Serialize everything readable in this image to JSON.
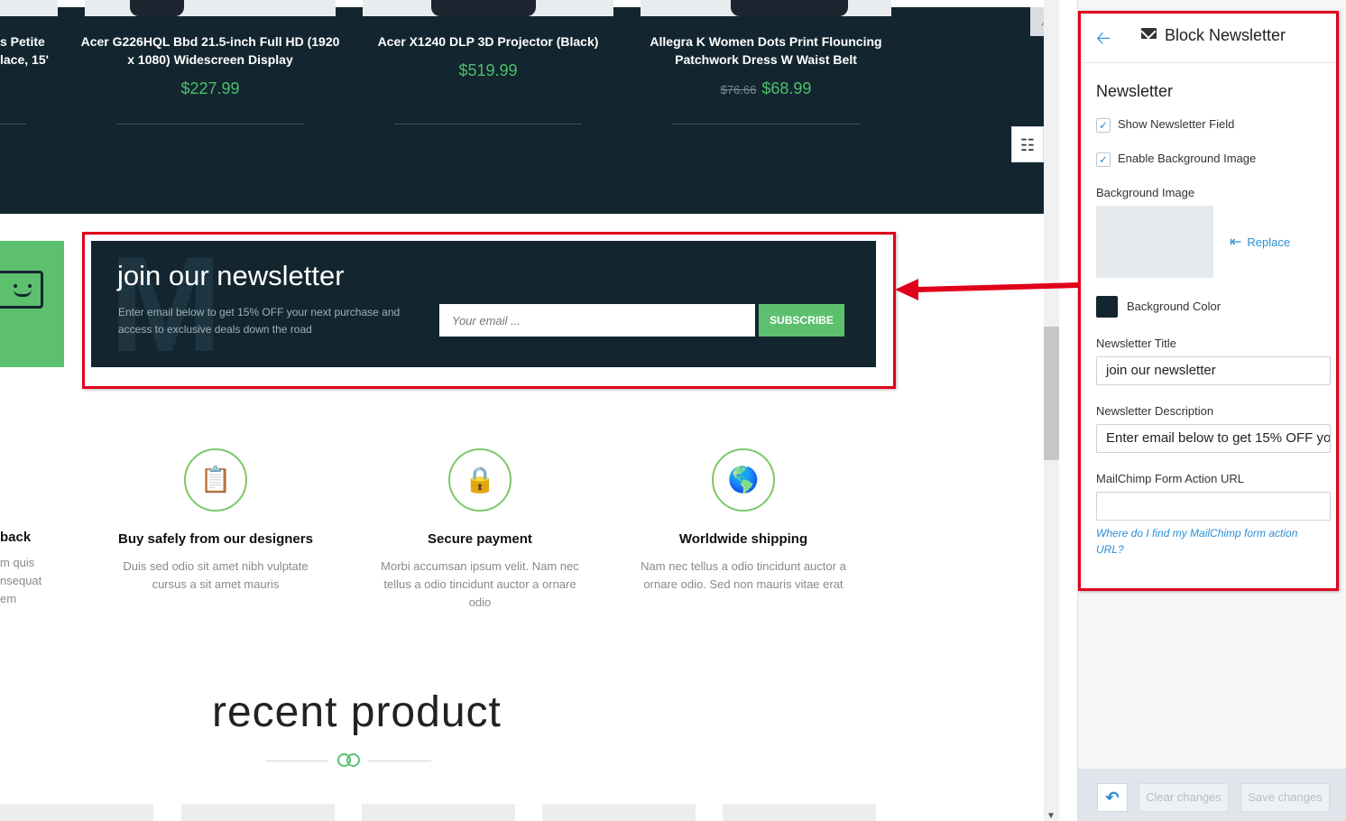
{
  "products": [
    {
      "name": "Acer G226HQL Bbd 21.5-inch Full HD (1920 x 1080) Widescreen Display",
      "price": "$227.99",
      "old_price": ""
    },
    {
      "name": "Acer X1240 DLP 3D Projector (Black)",
      "price": "$519.99",
      "old_price": ""
    },
    {
      "name": "Allegra K Women Dots Print Flouncing Patchwork Dress W Waist Belt",
      "price": "$68.99",
      "old_price": "$76.66"
    }
  ],
  "partial_product_name": "s Petite\nlace, 15'",
  "newsletter": {
    "title": "join our newsletter",
    "description": "Enter email below to get 15% OFF your next purchase and access to exclusive deals down the road",
    "placeholder": "Your email ...",
    "button": "SUBSCRIBE"
  },
  "features": [
    {
      "title": "Buy safely from our designers",
      "desc": "Duis sed odio sit amet nibh vulptate cursus a sit amet mauris",
      "icon": "clipboard-check-icon"
    },
    {
      "title": "Secure payment",
      "desc": "Morbi accumsan ipsum velit. Nam nec tellus a odio tincidunt auctor a ornare odio",
      "icon": "lock-icon"
    },
    {
      "title": "Worldwide shipping",
      "desc": "Nam nec tellus a odio tincidunt auctor a ornare odio. Sed non mauris vitae erat",
      "icon": "globe-icon"
    }
  ],
  "partial_feature": {
    "title": "back",
    "desc": "m quis\nnsequat\nem"
  },
  "recent_title": "recent product",
  "panel": {
    "title": "Block Newsletter",
    "section": "Newsletter",
    "show_field_label": "Show Newsletter Field",
    "show_field_checked": true,
    "enable_bg_label": "Enable Background Image",
    "enable_bg_checked": true,
    "bg_image_label": "Background Image",
    "replace_label": "Replace",
    "bg_color_label": "Background Color",
    "bg_color": "#13262f",
    "title_label": "Newsletter Title",
    "title_value": "join our newsletter",
    "desc_label": "Newsletter Description",
    "desc_value": "Enter email below to get 15% OFF yo",
    "mailchimp_label": "MailChimp Form Action URL",
    "mailchimp_value": "",
    "help_link": "Where do I find my MailChimp form action URL?",
    "clear_label": "Clear changes",
    "save_label": "Save changes"
  },
  "colors": {
    "accent": "#5cc06e",
    "dark": "#13262f",
    "link": "#2a8fd6",
    "highlight": "#e0001a"
  }
}
